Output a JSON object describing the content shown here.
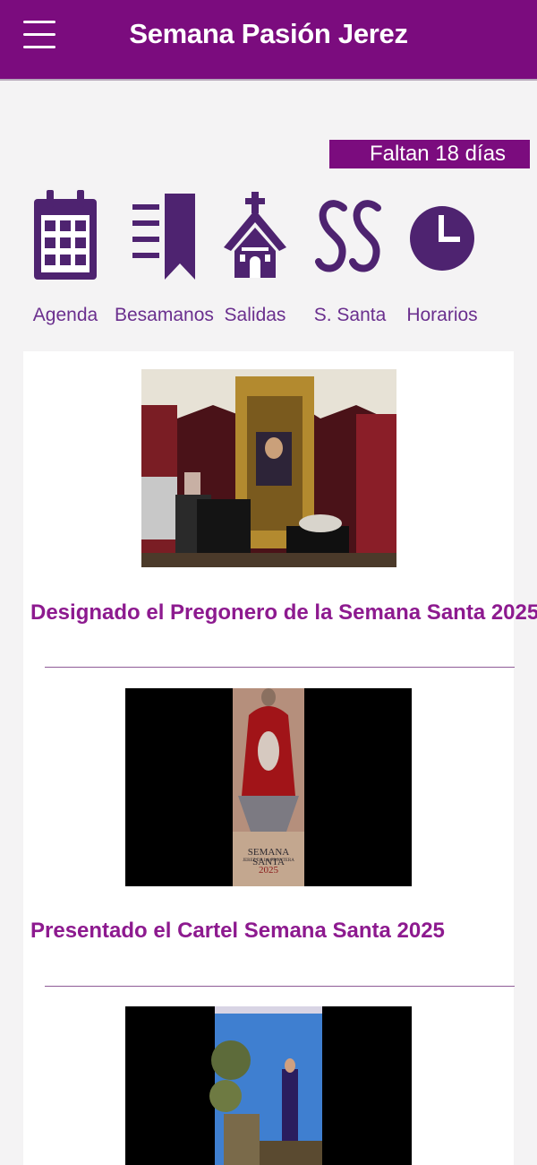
{
  "header": {
    "title": "Semana Pasión Jerez"
  },
  "countdown": "Faltan 18 días",
  "shortcuts": [
    {
      "label": "Agenda",
      "icon": "calendar-icon"
    },
    {
      "label": "Besamanos",
      "icon": "bookmark-list-icon"
    },
    {
      "label": "Salidas",
      "icon": "church-icon"
    },
    {
      "label": "S. Santa",
      "icon": "ss-logo-icon"
    },
    {
      "label": "Horarios",
      "icon": "clock-icon"
    }
  ],
  "news": [
    {
      "title": "Designado el Pregonero de la Semana Santa 2025"
    },
    {
      "title": "Presentado el Cartel Semana Santa 2025",
      "poster_text": [
        "SEMANA SANTA",
        "JEREZ DE LA FRONTERA",
        "2025"
      ]
    },
    {
      "title": ""
    }
  ],
  "colors": {
    "primary": "#7b0c7e",
    "icon": "#4e2370",
    "headline": "#8d1a8f"
  }
}
